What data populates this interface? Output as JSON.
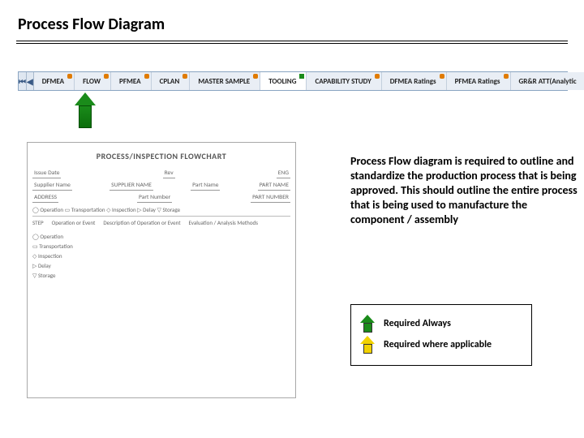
{
  "title": "Process Flow Diagram",
  "tabs": {
    "nav_first": "⏮",
    "nav_prev": "◀",
    "items": [
      "DFMEA",
      "FLOW",
      "PFMEA",
      "CPLAN",
      "MASTER SAMPLE",
      "TOOLING",
      "CAPABILITY STUDY",
      "DFMEA Ratings",
      "PFMEA Ratings",
      "GR&R ATT(Analytic"
    ]
  },
  "preview": {
    "title": "PROCESS/INSPECTION FLOWCHART",
    "hdr_left_a": "Supplier Name",
    "hdr_left_b": "SUPPLIER NAME",
    "hdr_left_c": "ADDRESS",
    "hdr_date_l": "Issue Date",
    "hdr_rev_l": "Rev",
    "hdr_rev_v": "ENG",
    "hdr_part_l": "Part Name",
    "hdr_part_v": "PART NAME",
    "hdr_num_l": "Part Number",
    "hdr_num_v": "PART NUMBER",
    "legend_line": "◯ Operation   ▭ Transportation   ◇ Inspection   ▷ Delay   ▽ Storage",
    "col1": "STEP",
    "col2": "Operation or Event",
    "col3": "Description of Operation or Event",
    "col4": "Evaluation / Analysis Methods",
    "items": [
      "◯  Operation",
      "▭  Transportation",
      "◇  Inspection",
      "▷  Delay",
      "▽  Storage"
    ]
  },
  "description": "Process Flow diagram is required to outline and standardize the production process that is being approved. This should outline the entire process that is being used to manufacture the component / assembly",
  "legend": {
    "green": "Required Always",
    "yellow": "Required where applicable"
  }
}
